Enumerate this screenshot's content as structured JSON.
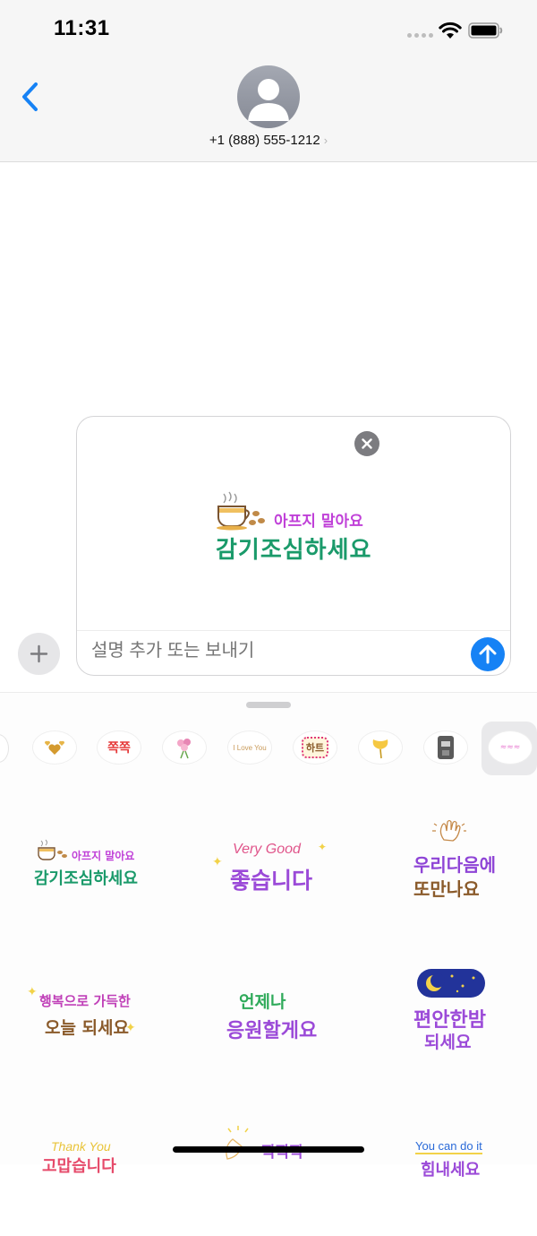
{
  "status_bar": {
    "time": "11:31"
  },
  "header": {
    "contact_number": "+1 (888) 555-1212",
    "back_icon": "chevron-left-icon",
    "avatar_icon": "person-icon"
  },
  "compose": {
    "placeholder": "설명 추가 또는 보내기",
    "preview_sticker": {
      "line1": "아프지 말아요",
      "line2": "감기조심하세요"
    }
  },
  "sticker_tray": [
    {
      "name": "hearts"
    },
    {
      "name": "jjokjjok",
      "label": "쪽쪽"
    },
    {
      "name": "flowers"
    },
    {
      "name": "i-love-you",
      "label": "I Love You"
    },
    {
      "name": "heart-frame",
      "label": "하트"
    },
    {
      "name": "ginkgo"
    },
    {
      "name": "coffee-machine"
    },
    {
      "name": "pink-text"
    }
  ],
  "stickers": [
    {
      "line1": "아프지 말아요",
      "line2": "감기조심하세요"
    },
    {
      "line1": "Very Good",
      "line2": "좋습니다"
    },
    {
      "line1": "우리다음에",
      "line2": "또만나요"
    },
    {
      "line1": "행복으로 가득한",
      "line2": "오늘 되세요"
    },
    {
      "line1": "언제나",
      "line2": "응원할게요"
    },
    {
      "line1": "편안한밤",
      "line2": "되세요"
    },
    {
      "line1": "Thank You",
      "line2": "고맙습니다"
    },
    {
      "line1": "",
      "line2": "짝짝짝"
    },
    {
      "line1": "You can do it",
      "line2": "힘내세요"
    }
  ]
}
